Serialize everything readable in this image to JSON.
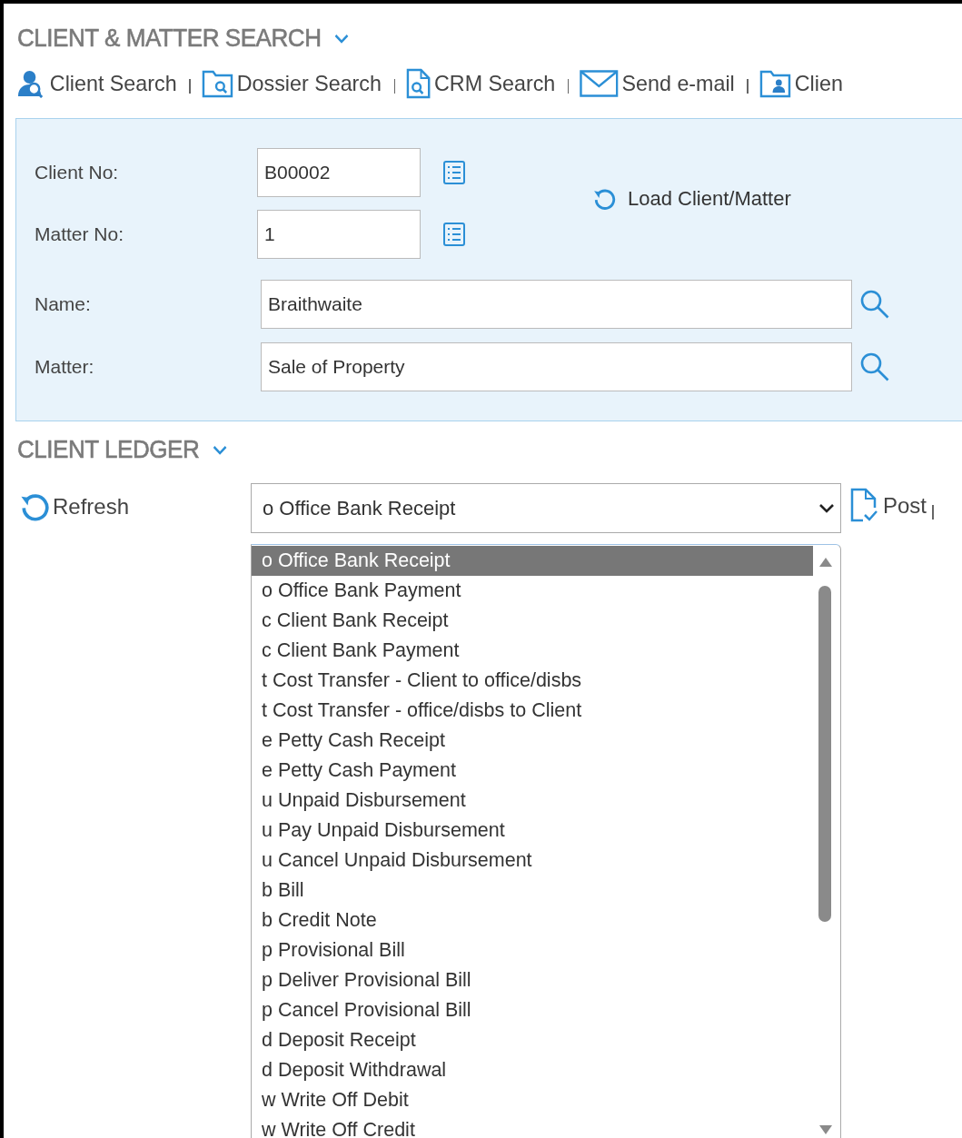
{
  "client_matter_search": {
    "title": "CLIENT & MATTER SEARCH",
    "expanded": true,
    "toolbar": [
      {
        "kind": "person-search",
        "label": "Client Search"
      },
      {
        "kind": "folder-search",
        "label": "Dossier Search"
      },
      {
        "kind": "document-search",
        "label": "CRM Search"
      },
      {
        "kind": "envelope",
        "label": "Send e-mail"
      },
      {
        "kind": "folder-person",
        "label": "Clien"
      }
    ],
    "fields": [
      {
        "kind": "lookup",
        "label": "Client No:",
        "value": "B00002"
      },
      {
        "kind": "lookup",
        "label": "Matter No:",
        "value": "1"
      },
      {
        "kind": "search",
        "label": "Name:",
        "value": "Braithwaite"
      },
      {
        "kind": "search",
        "label": "Matter:",
        "value": "Sale of Property"
      }
    ],
    "load_button": "Load Client/Matter"
  },
  "client_ledger": {
    "title": "CLIENT LEDGER",
    "expanded": true,
    "refresh_button": "Refresh",
    "transaction_type": {
      "value": "o Office Bank Receipt",
      "expanded": true,
      "options": [
        {
          "label": "o Office Bank Receipt",
          "selected": true
        },
        {
          "label": "o Office Bank Payment",
          "selected": false
        },
        {
          "label": "c Client Bank Receipt",
          "selected": false
        },
        {
          "label": "c Client Bank Payment",
          "selected": false
        },
        {
          "label": "t Cost Transfer - Client to office/disbs",
          "selected": false
        },
        {
          "label": "t Cost Transfer - office/disbs to Client",
          "selected": false
        },
        {
          "label": "e Petty Cash Receipt",
          "selected": false
        },
        {
          "label": "e Petty Cash Payment",
          "selected": false
        },
        {
          "label": "u Unpaid Disbursement",
          "selected": false
        },
        {
          "label": "u Pay Unpaid Disbursement",
          "selected": false
        },
        {
          "label": "u Cancel Unpaid Disbursement",
          "selected": false
        },
        {
          "label": "b Bill",
          "selected": false
        },
        {
          "label": "b Credit Note",
          "selected": false
        },
        {
          "label": "p Provisional Bill",
          "selected": false
        },
        {
          "label": "p Deliver Provisional Bill",
          "selected": false
        },
        {
          "label": "p Cancel Provisional Bill",
          "selected": false
        },
        {
          "label": "d Deposit Receipt",
          "selected": false
        },
        {
          "label": "d Deposit Withdrawal",
          "selected": false
        },
        {
          "label": "w Write Off Debit",
          "selected": false
        },
        {
          "label": "w Write Off Credit",
          "selected": false
        }
      ]
    },
    "post_button": "Post"
  }
}
